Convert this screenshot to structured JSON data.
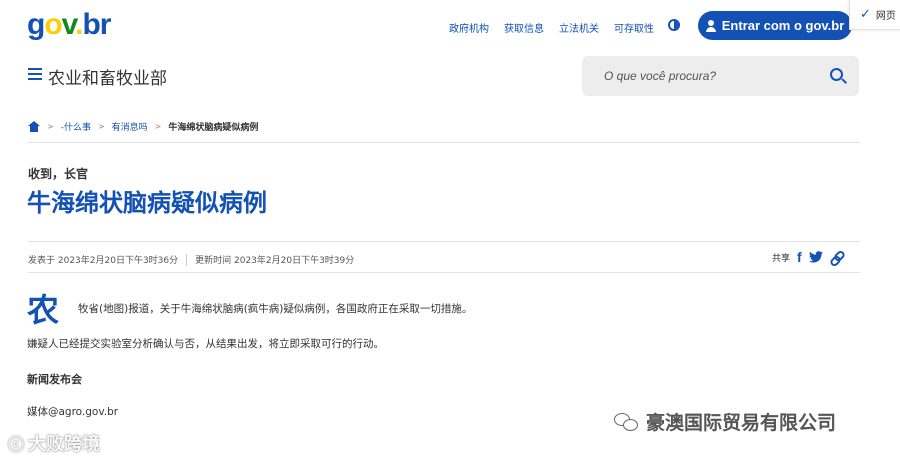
{
  "header": {
    "logo": {
      "g": "g",
      "o": "o",
      "v": "v",
      "dot": ".",
      "br": "br"
    },
    "nav": [
      "政府机构",
      "获取信息",
      "立法机关",
      "可存取性"
    ],
    "login_label": "Entrar com o gov.br",
    "popup_label": "网页"
  },
  "subheader": {
    "title": "农业和畜牧业部",
    "search_placeholder": "O que você procura?"
  },
  "breadcrumb": {
    "items": [
      "-什么事",
      "有消息吗"
    ],
    "current": "牛海绵状脑病疑似病例"
  },
  "article": {
    "kicker": "收到，长官",
    "headline": "牛海绵状脑病疑似病例",
    "published": "发表于 2023年2月20日下午3时36分",
    "updated": "更新时间 2023年2月20日下午3时39分",
    "share_label": "共享",
    "share_icons": {
      "facebook": "f",
      "twitter": "t"
    },
    "dropcap": "农",
    "paragraph1": "牧省(地图)报道，关于牛海绵状脑病(疯牛病)疑似病例，各国政府正在采取一切措施。",
    "paragraph2": "嫌疑人已经提交实验室分析确认与否，从结果出发，将立即采取可行的行动。",
    "subhead": "新闻发布会",
    "email": "媒体@agro.gov.br"
  },
  "watermarks": {
    "left": "大败跨境",
    "left_logo": "ⓒ",
    "right": "豪澳国际贸易有限公司"
  },
  "colors": {
    "primary": "#1351b4",
    "text": "#333333",
    "search_bg": "#ededed"
  }
}
